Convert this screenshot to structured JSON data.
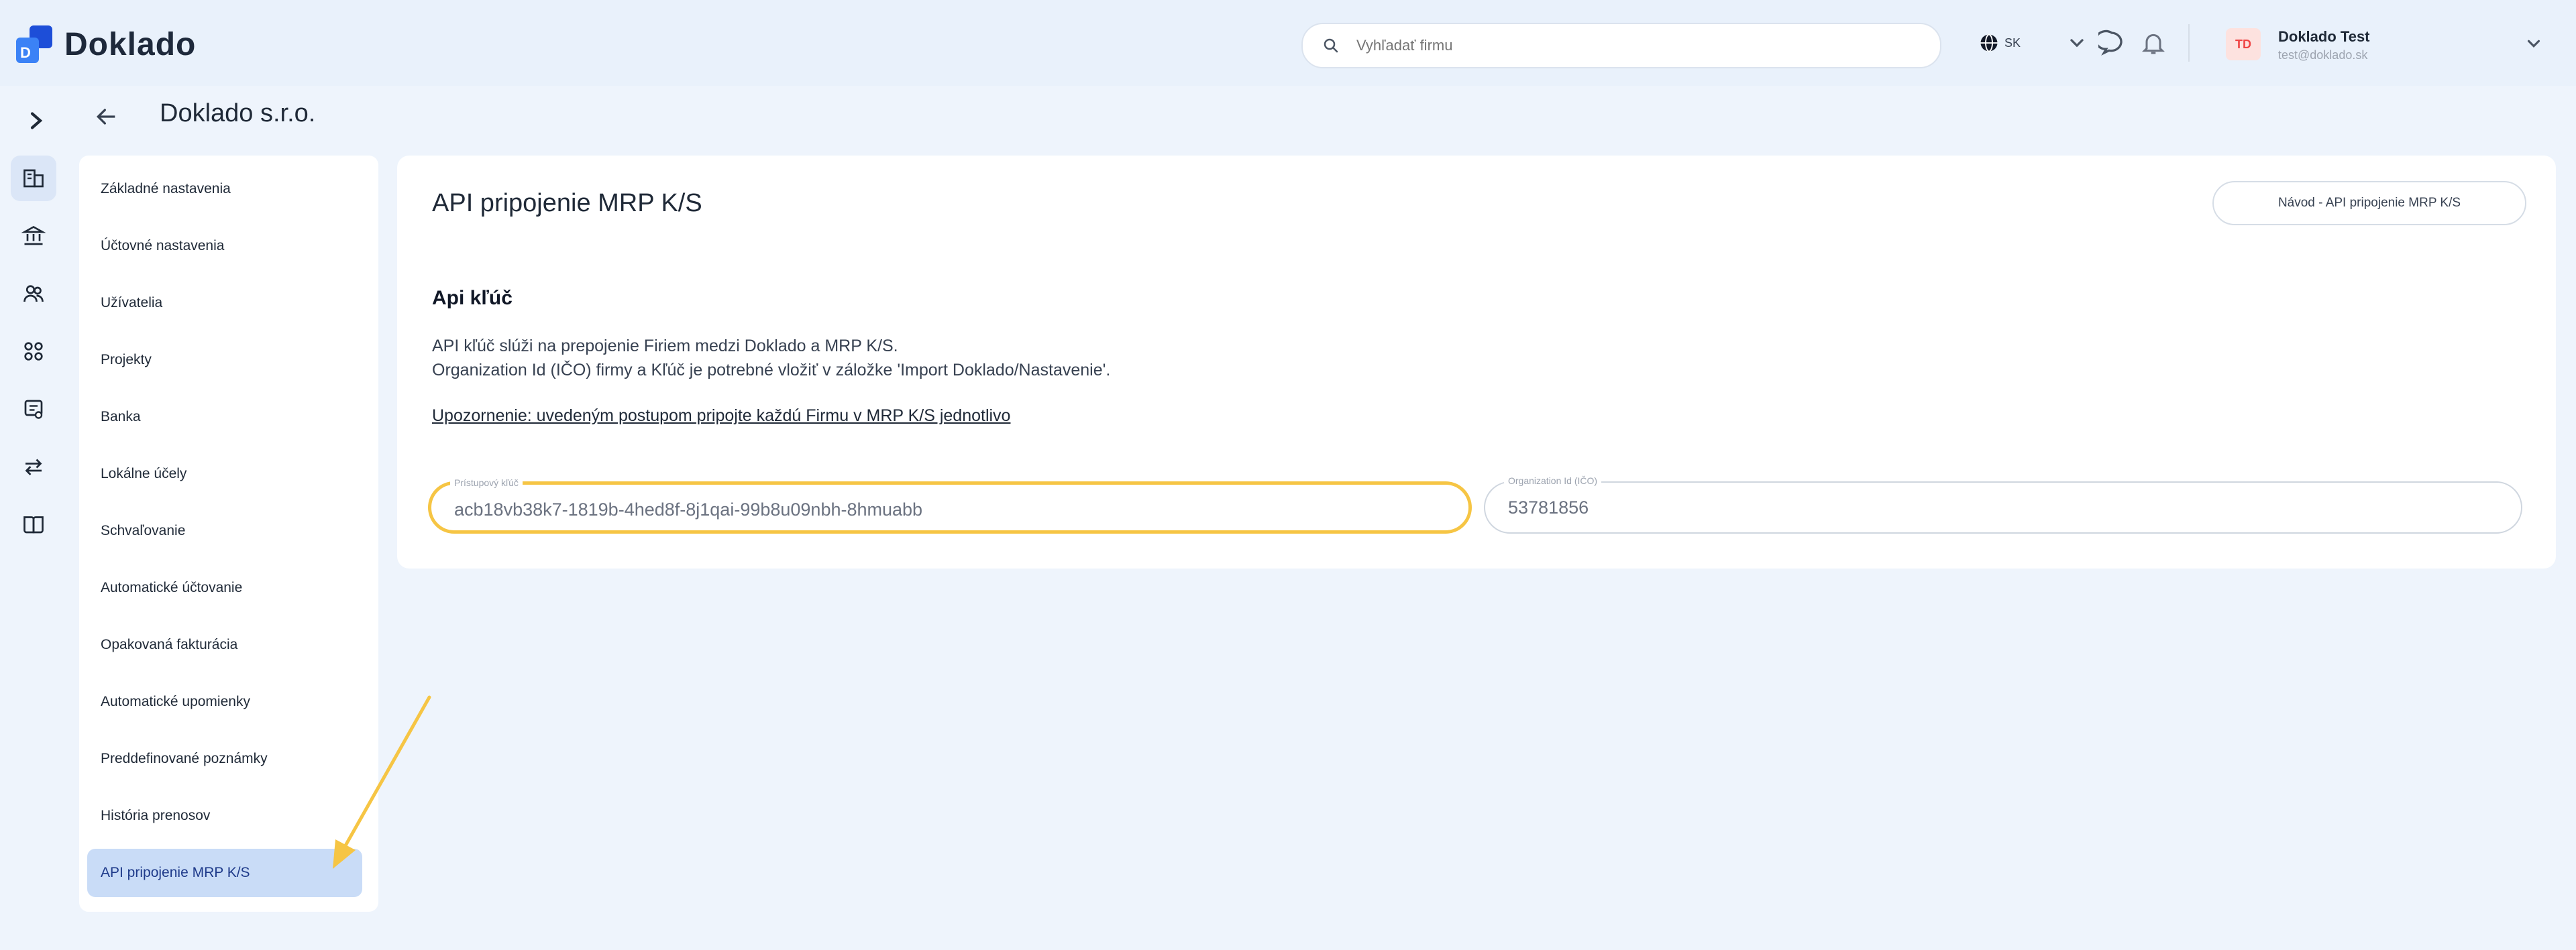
{
  "brand": {
    "name": "Doklado",
    "logo_letter": "D"
  },
  "search": {
    "placeholder": "Vyhľadať firmu"
  },
  "language": {
    "code": "SK"
  },
  "user": {
    "initials": "TD",
    "name": "Doklado Test",
    "email": "test@doklado.sk"
  },
  "breadcrumb": {
    "company": "Doklado s.r.o."
  },
  "rail": {
    "items": [
      {
        "icon": "building-icon",
        "active": true
      },
      {
        "icon": "bank-icon"
      },
      {
        "icon": "users-icon"
      },
      {
        "icon": "projects-icon"
      },
      {
        "icon": "receipt-icon"
      },
      {
        "icon": "transfer-icon"
      },
      {
        "icon": "book-icon"
      }
    ]
  },
  "menu": {
    "items": [
      {
        "label": "Základné nastavenia"
      },
      {
        "label": "Účtovné nastavenia"
      },
      {
        "label": "Užívatelia"
      },
      {
        "label": "Projekty"
      },
      {
        "label": "Banka"
      },
      {
        "label": "Lokálne účely"
      },
      {
        "label": "Schvaľovanie"
      },
      {
        "label": "Automatické účtovanie"
      },
      {
        "label": "Opakovaná fakturácia"
      },
      {
        "label": "Automatické upomienky"
      },
      {
        "label": "Preddefinované poznámky"
      },
      {
        "label": "História prenosov"
      },
      {
        "label": "API pripojenie MRP K/S",
        "active": true
      }
    ]
  },
  "panel": {
    "title": "API pripojenie MRP K/S",
    "guide_button": "Návod - API pripojenie MRP K/S",
    "section_title": "Api kľúč",
    "desc_line1": "API kľúč slúži na prepojenie Firiem medzi Doklado a MRP K/S.",
    "desc_line2": "Organization Id (IČO) firmy a Kľúč je potrebné vložiť v záložke 'Import Doklado/Nastavenie'.",
    "warning": "Upozornenie: uvedeným postupom pripojte každú Firmu v MRP K/S jednotlivo",
    "api_key_label": "Prístupový kľúč",
    "api_key_value": "acb18vb38k7-1819b-4hed8f-8j1qai-99b8u09nbh-8hmuabb",
    "org_id_label": "Organization Id (IČO)",
    "org_id_value": "53781856"
  },
  "colors": {
    "accent": "#3b82f6",
    "highlight": "#f6c544",
    "active_menu": "#c9dcf7"
  }
}
